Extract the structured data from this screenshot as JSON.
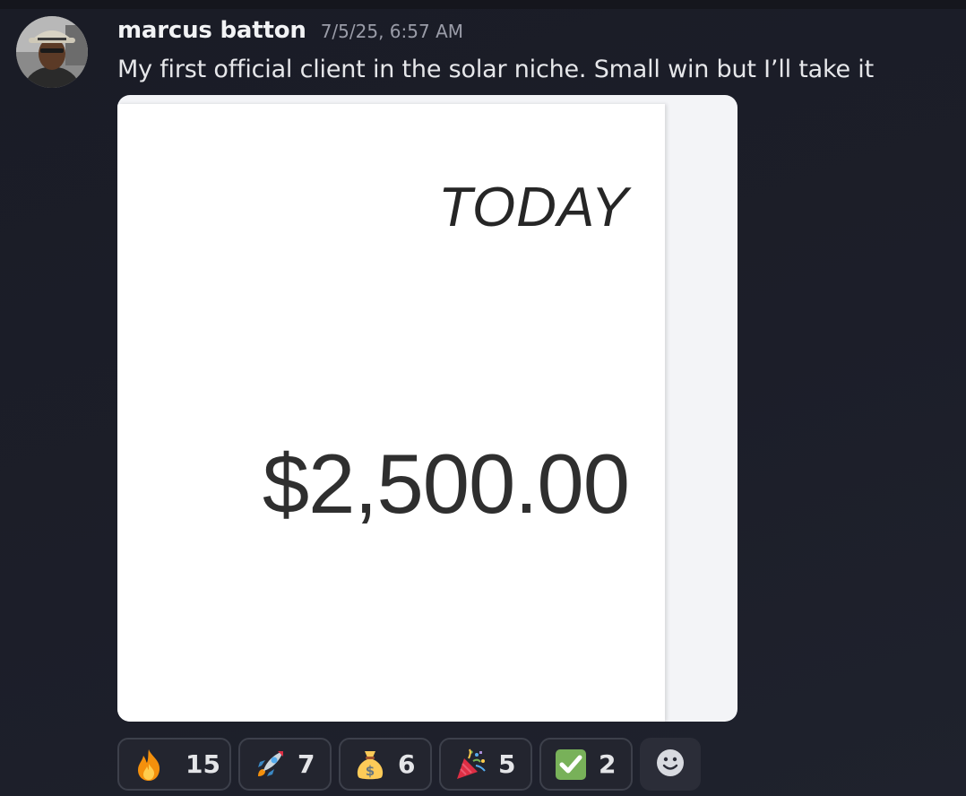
{
  "message": {
    "author": "marcus batton",
    "timestamp": "7/5/25, 6:57 AM",
    "text": "My first official client in the solar niche. Small win but I’ll take it"
  },
  "attachment": {
    "heading": "TODAY",
    "amount": "$2,500.00"
  },
  "reactions": [
    {
      "emoji": "fire-emoji",
      "count": "15"
    },
    {
      "emoji": "rocket-emoji",
      "count": "7"
    },
    {
      "emoji": "money-bag-emoji",
      "count": "6"
    },
    {
      "emoji": "party-popper-emoji",
      "count": "5"
    },
    {
      "emoji": "check-mark-button-emoji",
      "count": "2"
    }
  ],
  "add_reaction_icon": "smiley-add-reaction-icon",
  "colors": {
    "background": "#1c1e29",
    "author": "#f2f3f5",
    "timestamp": "#9a9ca8",
    "reaction_border": "#3d404b",
    "check_green": "#78b159"
  }
}
